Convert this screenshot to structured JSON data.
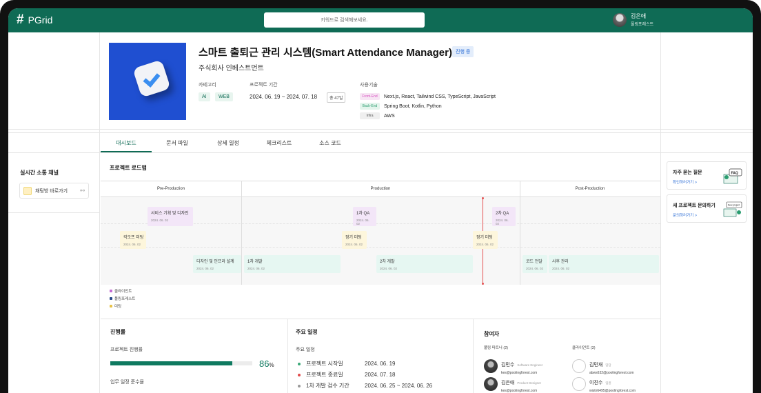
{
  "app": {
    "name": "PGrid",
    "logo_icon": "#"
  },
  "search": {
    "placeholder": "키워드로 검색해보세요."
  },
  "user": {
    "name": "김은애",
    "team": "풀링포레스트"
  },
  "project": {
    "title": "스마트 출퇴근 관리 시스템(Smart Attendance Manager)",
    "status": "진행 중",
    "company": "주식회사 인베스트먼트",
    "category_label": "카테고리",
    "categories": [
      "AI",
      "WEB"
    ],
    "period_label": "프로젝트 기간",
    "period": "2024. 06. 19 ~ 2024. 07. 18",
    "duration": "총 47일",
    "tech_label": "사용기술",
    "tech": [
      {
        "tag": "Front-End",
        "value": "Next.js, React, Tailwind CSS, TypeScript, JavaScript",
        "color": "#d64fbf",
        "bg": "#f7e5f4"
      },
      {
        "tag": "Back-End",
        "value": "Spring Boot, Kotlin, Python",
        "color": "#2a9d70",
        "bg": "#e3f5ec"
      },
      {
        "tag": "Infra",
        "value": "AWS",
        "color": "#555555",
        "bg": "#efefef"
      }
    ]
  },
  "tabs": [
    "대시보드",
    "문서 파일",
    "상세 일정",
    "체크리스트",
    "소스 코드"
  ],
  "active_tab": 0,
  "channel": {
    "title": "실시간 소통 채널",
    "item": "채팅방 바로가기",
    "link_icon": "link-icon"
  },
  "roadmap": {
    "title": "프로젝트 로드맵",
    "phases": [
      "Pre-Production",
      "Production",
      "Post-Production"
    ],
    "events": [
      {
        "title": "서비스 기획 및 디자인",
        "date": "2024. 06. 02",
        "type": "client"
      },
      {
        "title": "킥오프 미팅",
        "date": "2024. 06. 02",
        "type": "meet"
      },
      {
        "title": "디자인 및 인프라 설계",
        "date": "2024. 06. 02",
        "type": "pool"
      },
      {
        "title": "1차 개발",
        "date": "2024. 06. 02",
        "type": "pool"
      },
      {
        "title": "1차 QA",
        "date": "2024. 06. 02",
        "type": "client"
      },
      {
        "title": "정기 미팅",
        "date": "2024. 06. 02",
        "type": "meet"
      },
      {
        "title": "2차 개발",
        "date": "2024. 06. 02",
        "type": "pool"
      },
      {
        "title": "정기 미팅",
        "date": "2024. 06. 02",
        "type": "meet"
      },
      {
        "title": "2차 QA",
        "date": "2024. 06. 02",
        "type": "client"
      },
      {
        "title": "코드 전달",
        "date": "2024. 06. 02",
        "type": "pool"
      },
      {
        "title": "사후 관리",
        "date": "2024. 06. 02",
        "type": "pool"
      }
    ],
    "legend": [
      {
        "label": "클라이언트",
        "color": "#c36ad3"
      },
      {
        "label": "풀링포레스트",
        "color": "#2a4a8a"
      },
      {
        "label": "미팅",
        "color": "#e8c248"
      }
    ]
  },
  "progress": {
    "title": "진행률",
    "label": "프로젝트 진행률",
    "value": 86,
    "value_text": "86",
    "unit": "%",
    "next_label": "업무 일정 준수율"
  },
  "schedule": {
    "title": "주요 일정",
    "subtitle": "주요 일정",
    "items": [
      {
        "label": "프로젝트 시작일",
        "date": "2024. 06. 19",
        "color": "#3aa877"
      },
      {
        "label": "프로젝트 종료일",
        "date": "2024. 07. 18",
        "color": "#e14b4b"
      },
      {
        "label": "1차 개발 검수 기간",
        "date": "2024. 06. 25  ~ 2024. 06. 26",
        "color": "#999999"
      }
    ]
  },
  "participants": {
    "title": "참여자",
    "pooling_label": "풀링 파트너 (2)",
    "client_label": "클라이언트 (3)",
    "pooling": [
      {
        "name": "김민수",
        "role": "Software Engineer",
        "email": "kes@poolingforest.com"
      },
      {
        "name": "김은애",
        "role": "Product Designer",
        "email": "kes@poolingforest.com"
      }
    ],
    "clients": [
      {
        "name": "김민재",
        "role": "담당",
        "email": "abws632@poolingforest.com"
      },
      {
        "name": "이진수",
        "role": "임원",
        "email": "wistn6495@poolingforest.com"
      }
    ]
  },
  "side_cards": [
    {
      "title": "자주 묻는 질문",
      "link": "확인하러가기 >",
      "art": "FAQ"
    },
    {
      "title": "새 프로젝트 문의하기",
      "link": "문의하러가기 >",
      "art": "New project"
    }
  ]
}
